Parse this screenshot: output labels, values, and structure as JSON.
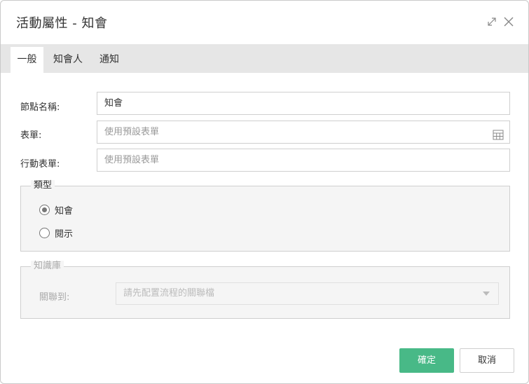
{
  "dialog": {
    "title": "活動屬性 - 知會",
    "expand_icon": "expand-arrows-icon",
    "close_icon": "close-x-icon"
  },
  "tabs": [
    {
      "label": "一般",
      "active": true
    },
    {
      "label": "知會人",
      "active": false
    },
    {
      "label": "通知",
      "active": false
    }
  ],
  "form": {
    "node_name": {
      "label": "節點名稱:",
      "value": "知會"
    },
    "form_field": {
      "label": "表單:",
      "placeholder": "使用預設表單",
      "icon": "table-grid-icon"
    },
    "mobile_form": {
      "label": "行動表單:",
      "placeholder": "使用預設表單"
    }
  },
  "type_group": {
    "legend": "類型",
    "options": [
      {
        "label": "知會",
        "checked": true
      },
      {
        "label": "閱示",
        "checked": false
      }
    ]
  },
  "knowledge_group": {
    "legend": "知識庫",
    "label": "關聯到:",
    "select_text": "請先配置流程的關聯檔",
    "disabled": true
  },
  "buttons": {
    "confirm": "確定",
    "cancel": "取消"
  },
  "colors": {
    "primary": "#48b987",
    "tab_bar": "#e6e6e6",
    "group_bg": "#f5f5f5"
  }
}
